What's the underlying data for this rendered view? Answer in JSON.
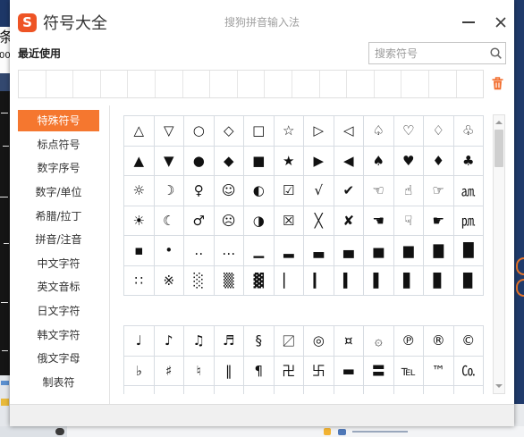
{
  "window": {
    "logo_letter": "S",
    "title": "符号大全",
    "subtitle": "搜狗拼音输入法",
    "logo_color": "#ee5425",
    "accent_color": "#f5772f",
    "minimize_icon": "minimize-icon",
    "close_icon": "close-icon"
  },
  "recent": {
    "label": "最近使用",
    "items": [
      "",
      "",
      "",
      "",
      "",
      "",
      "",
      "",
      "",
      "",
      "",
      "",
      "",
      "",
      "",
      "",
      ""
    ],
    "clear_icon": "trash-icon",
    "clear_icon_color": "#f26d2d"
  },
  "search": {
    "placeholder": "搜索符号",
    "icon": "search-icon"
  },
  "categories": [
    {
      "label": "特殊符号",
      "selected": true
    },
    {
      "label": "标点符号",
      "selected": false
    },
    {
      "label": "数字序号",
      "selected": false
    },
    {
      "label": "数字/单位",
      "selected": false
    },
    {
      "label": "希腊/拉丁",
      "selected": false
    },
    {
      "label": "拼音/注音",
      "selected": false
    },
    {
      "label": "中文字符",
      "selected": false
    },
    {
      "label": "英文音标",
      "selected": false
    },
    {
      "label": "日文字符",
      "selected": false
    },
    {
      "label": "韩文字符",
      "selected": false
    },
    {
      "label": "俄文字母",
      "selected": false
    },
    {
      "label": "制表符",
      "selected": false
    }
  ],
  "symbol_groups": [
    {
      "rows": [
        [
          "△",
          "▽",
          "○",
          "◇",
          "□",
          "☆",
          "▷",
          "◁",
          "♤",
          "♡",
          "♢",
          "♧"
        ],
        [
          "▲",
          "▼",
          "●",
          "◆",
          "■",
          "★",
          "▶",
          "◀",
          "♠",
          "♥",
          "♦",
          "♣"
        ],
        [
          "☼",
          "☽",
          "♀",
          "☺",
          "◐",
          "☑",
          "√",
          "✔",
          "☜",
          "☝",
          "☞",
          "㏂"
        ],
        [
          "☀",
          "☾",
          "♂",
          "☹",
          "◑",
          "☒",
          "╳",
          "✘",
          "☚",
          "☟",
          "☛",
          "㏘"
        ],
        [
          "▪",
          "•",
          "‥",
          "…",
          "▁",
          "▂",
          "▃",
          "▄",
          "▅",
          "▆",
          "▇",
          "█"
        ],
        [
          "∷",
          "※",
          "░",
          "▒",
          "▓",
          "▏",
          "▎",
          "▍",
          "▌",
          "▋",
          "▊",
          "▉"
        ]
      ]
    },
    {
      "rows": [
        [
          "♩",
          "♪",
          "♫",
          "♬",
          "§",
          "〼",
          "◎",
          "¤",
          "۞",
          "℗",
          "®",
          "©"
        ],
        [
          "♭",
          "♯",
          "♮",
          "‖",
          "¶",
          "卍",
          "卐",
          "▬",
          "〓",
          "℡",
          "™",
          "㏇"
        ],
        [
          "",
          "",
          "",
          "",
          "",
          "",
          "",
          "",
          "",
          "",
          "",
          ""
        ]
      ]
    }
  ],
  "scrollbar": {
    "up_icon": "arrow-up-icon",
    "down_icon": "arrow-down-icon",
    "position": 0,
    "visible_fraction": 0.15
  },
  "background": {
    "left_fragments": [
      "条",
      "00"
    ]
  }
}
